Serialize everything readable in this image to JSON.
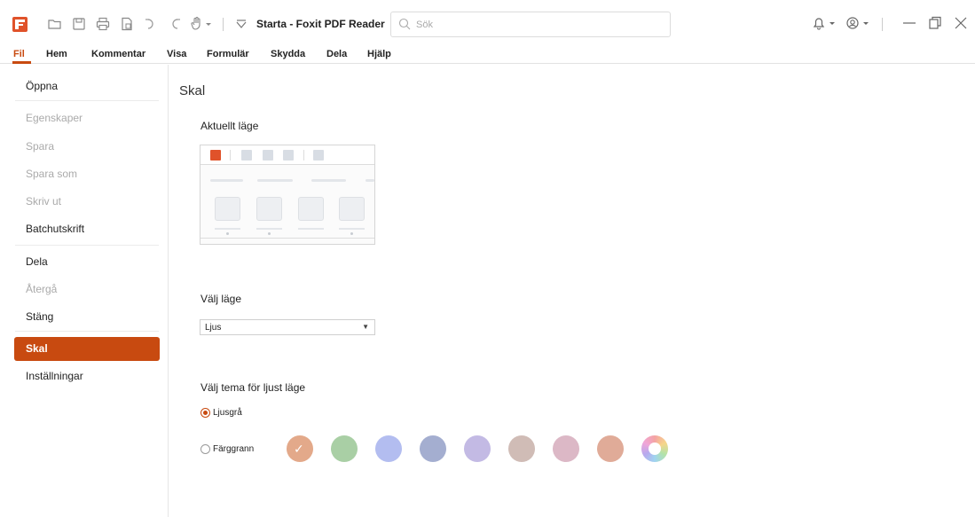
{
  "titlebar": {
    "app_title": "Starta - Foxit PDF Reader",
    "search_placeholder": "Sök",
    "icons": [
      "foxit-logo-icon",
      "open-folder-icon",
      "save-icon",
      "print-icon",
      "document-icon",
      "undo-icon",
      "redo-icon",
      "hand-tool-icon",
      "quick-access-dropdown-icon",
      "bell-icon",
      "account-icon",
      "minimize-icon",
      "restore-icon",
      "close-icon"
    ]
  },
  "menubar": {
    "items": [
      "Fil",
      "Hem",
      "Kommentar",
      "Visa",
      "Formulär",
      "Skydda",
      "Dela",
      "Hjälp"
    ],
    "active": "Fil"
  },
  "sidebar": {
    "items": [
      {
        "label": "Öppna",
        "enabled": true
      },
      {
        "label": "Egenskaper",
        "enabled": false
      },
      {
        "label": "Spara",
        "enabled": false
      },
      {
        "label": "Spara som",
        "enabled": false
      },
      {
        "label": "Skriv ut",
        "enabled": false
      },
      {
        "label": "Batchutskrift",
        "enabled": true
      },
      {
        "label": "Dela",
        "enabled": true
      },
      {
        "label": "Återgå",
        "enabled": false
      },
      {
        "label": "Stäng",
        "enabled": true
      },
      {
        "label": "Skal",
        "enabled": true,
        "selected": true
      },
      {
        "label": "Inställningar",
        "enabled": true
      }
    ]
  },
  "main": {
    "title": "Skal",
    "current_mode_label": "Aktuellt läge",
    "choose_mode_label": "Välj läge",
    "mode_select_value": "Ljus",
    "theme_label": "Välj tema för ljust läge",
    "theme_options": [
      {
        "label": "Ljusgrå",
        "checked": true
      },
      {
        "label": "Färggrann",
        "checked": false
      }
    ],
    "swatches": [
      "#e3a98a",
      "#a9cfa5",
      "#b3bdf0",
      "#a4aed0",
      "#c3bae4",
      "#d0bcb6",
      "#dcb8c6",
      "#e0ab98",
      "rainbow"
    ],
    "selected_swatch": 0
  },
  "colors": {
    "accent": "#c84a10",
    "logo": "#e0522a"
  }
}
